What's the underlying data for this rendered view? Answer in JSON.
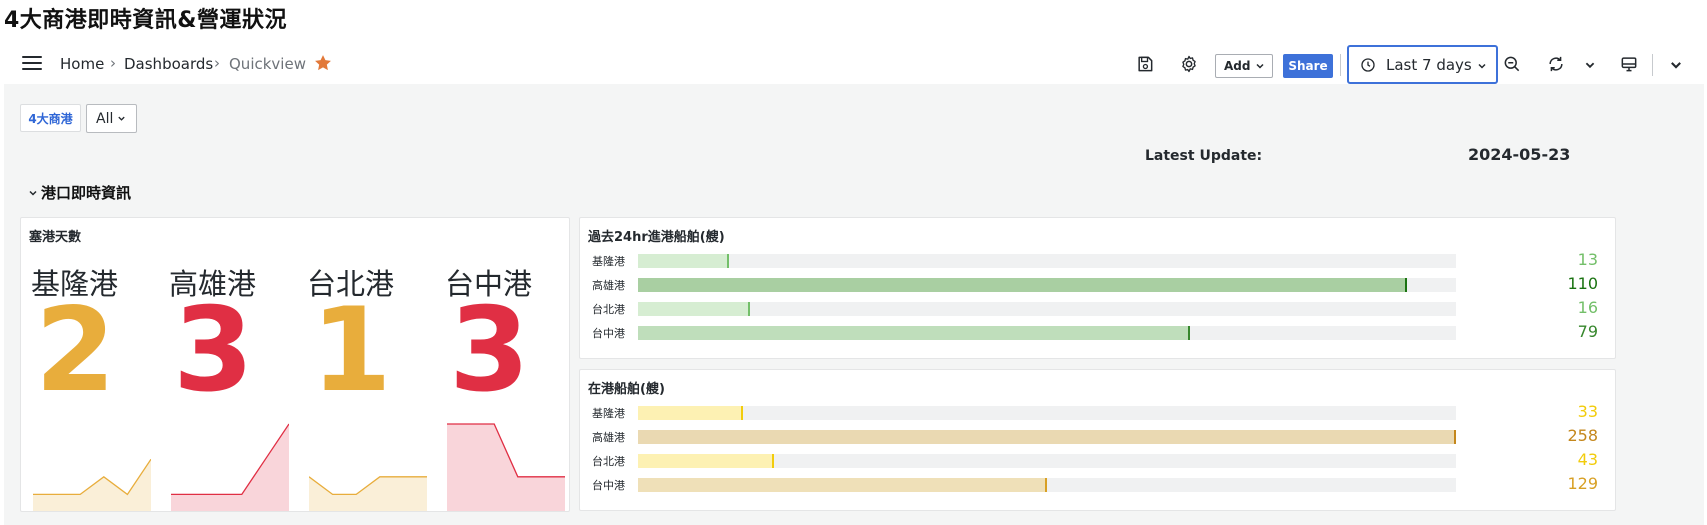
{
  "page_title": "4大商港即時資訊&營運狀況",
  "breadcrumb": {
    "home": "Home",
    "dashboards": "Dashboards",
    "current": "Quickview",
    "separator": "›"
  },
  "toolbar": {
    "add_label": "Add",
    "share_label": "Share",
    "time_range": "Last 7 days"
  },
  "variables": {
    "label": "4大商港",
    "selected": "All"
  },
  "latest_update": {
    "label": "Latest Update:",
    "value": "2024-05-23"
  },
  "row_title": "港口即時資訊",
  "colors": {
    "accent": "#3d71d9",
    "yellow": "#e5ac3e",
    "red": "#e02f44",
    "green": "#56a64b",
    "gold": "#f2c94c"
  },
  "panel_stats": {
    "title": "塞港天數",
    "items": [
      {
        "name": "基隆港",
        "value": "2",
        "color": "#e8ad3c",
        "spark": [
          1,
          1,
          1,
          2,
          1,
          3
        ]
      },
      {
        "name": "高雄港",
        "value": "3",
        "color": "#e02f44",
        "spark": [
          1,
          1,
          1,
          1,
          3,
          5
        ]
      },
      {
        "name": "台北港",
        "value": "1",
        "color": "#e8ad3c",
        "spark": [
          2,
          1,
          1,
          2,
          2,
          2
        ]
      },
      {
        "name": "台中港",
        "value": "3",
        "color": "#e02f44",
        "spark": [
          5,
          5,
          5,
          2,
          2,
          2
        ]
      }
    ]
  },
  "panel_arrivals": {
    "title": "過去24hr進港船舶(艘)",
    "max": 117,
    "items": [
      {
        "name": "基隆港",
        "value": 13,
        "display": "13",
        "fill": "#d6edd2",
        "tick": "#73bf69",
        "text": "#73bf69"
      },
      {
        "name": "高雄港",
        "value": 110,
        "display": "110",
        "fill": "#a9cfa2",
        "tick": "#1a7311",
        "text": "#1a7311"
      },
      {
        "name": "台北港",
        "value": 16,
        "display": "16",
        "fill": "#d6edd2",
        "tick": "#73bf69",
        "text": "#73bf69"
      },
      {
        "name": "台中港",
        "value": 79,
        "display": "79",
        "fill": "#bfdebb",
        "tick": "#37872d",
        "text": "#37872d"
      }
    ]
  },
  "panel_in_port": {
    "title": "在港船舶(艘)",
    "max": 258,
    "items": [
      {
        "name": "基隆港",
        "value": 33,
        "display": "33",
        "fill": "#fdf1b3",
        "tick": "#f2cc0c",
        "text": "#f2cc0c"
      },
      {
        "name": "高雄港",
        "value": 258,
        "display": "258",
        "fill": "#ead9b2",
        "tick": "#c4871c",
        "text": "#c4871c"
      },
      {
        "name": "台北港",
        "value": 43,
        "display": "43",
        "fill": "#fdf1b3",
        "tick": "#f2cc0c",
        "text": "#f2cc0c"
      },
      {
        "name": "台中港",
        "value": 129,
        "display": "129",
        "fill": "#efe0b8",
        "tick": "#d8a024",
        "text": "#d8a024"
      }
    ]
  }
}
